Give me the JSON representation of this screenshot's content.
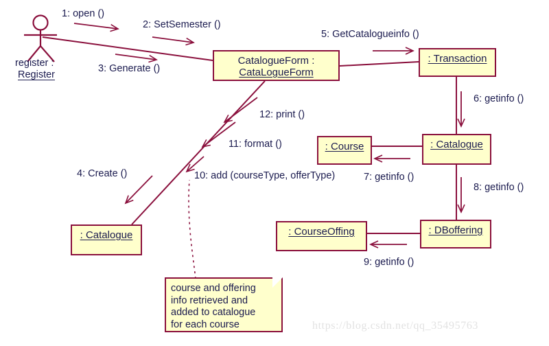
{
  "diagram": {
    "title": "UML Collaboration Diagram",
    "colors": {
      "box_fill": "#ffffcc",
      "box_border": "#8a0f3c",
      "link_line": "#8a0f3c",
      "text": "#1a1a4e",
      "background": "#ffffff",
      "watermark": "#e2e2e2"
    }
  },
  "actor": {
    "name": "register-actor",
    "label_line1": "register :",
    "label_line2": "Register"
  },
  "objects": [
    {
      "id": "catalogueform",
      "line1": "CatalogueForm :",
      "line2": "CataLogueForm",
      "two_line": true
    },
    {
      "id": "transaction",
      "label": ": Transaction",
      "two_line": false
    },
    {
      "id": "course",
      "label": ": Course",
      "two_line": false
    },
    {
      "id": "catalogue_right",
      "label": ": Catalogue",
      "two_line": false
    },
    {
      "id": "courseoffing",
      "label": ": CourseOffing",
      "two_line": false
    },
    {
      "id": "dboffering",
      "label": ": DBoffering",
      "two_line": false
    },
    {
      "id": "catalogue_left",
      "label": ": Catalogue",
      "two_line": false
    }
  ],
  "messages": [
    {
      "seq": "1",
      "text": "1: open ()"
    },
    {
      "seq": "2",
      "text": "2: SetSemester ()"
    },
    {
      "seq": "3",
      "text": "3: Generate ()"
    },
    {
      "seq": "4",
      "text": "4: Create ()"
    },
    {
      "seq": "5",
      "text": "5: GetCatalogueinfo ()"
    },
    {
      "seq": "6",
      "text": "6: getinfo ()"
    },
    {
      "seq": "7",
      "text": "7: getinfo ()"
    },
    {
      "seq": "8",
      "text": "8: getinfo ()"
    },
    {
      "seq": "9",
      "text": "9: getinfo ()"
    },
    {
      "seq": "10",
      "text": "10: add (courseType, offerType)"
    },
    {
      "seq": "11",
      "text": "11: format ()"
    },
    {
      "seq": "12",
      "text": "12: print ()"
    }
  ],
  "note": {
    "line1": "course and offering",
    "line2": "info retrieved and",
    "line3": "added to catalogue",
    "line4": "for each course"
  },
  "watermark": {
    "text": "https://blog.csdn.net/qq_35495763"
  }
}
